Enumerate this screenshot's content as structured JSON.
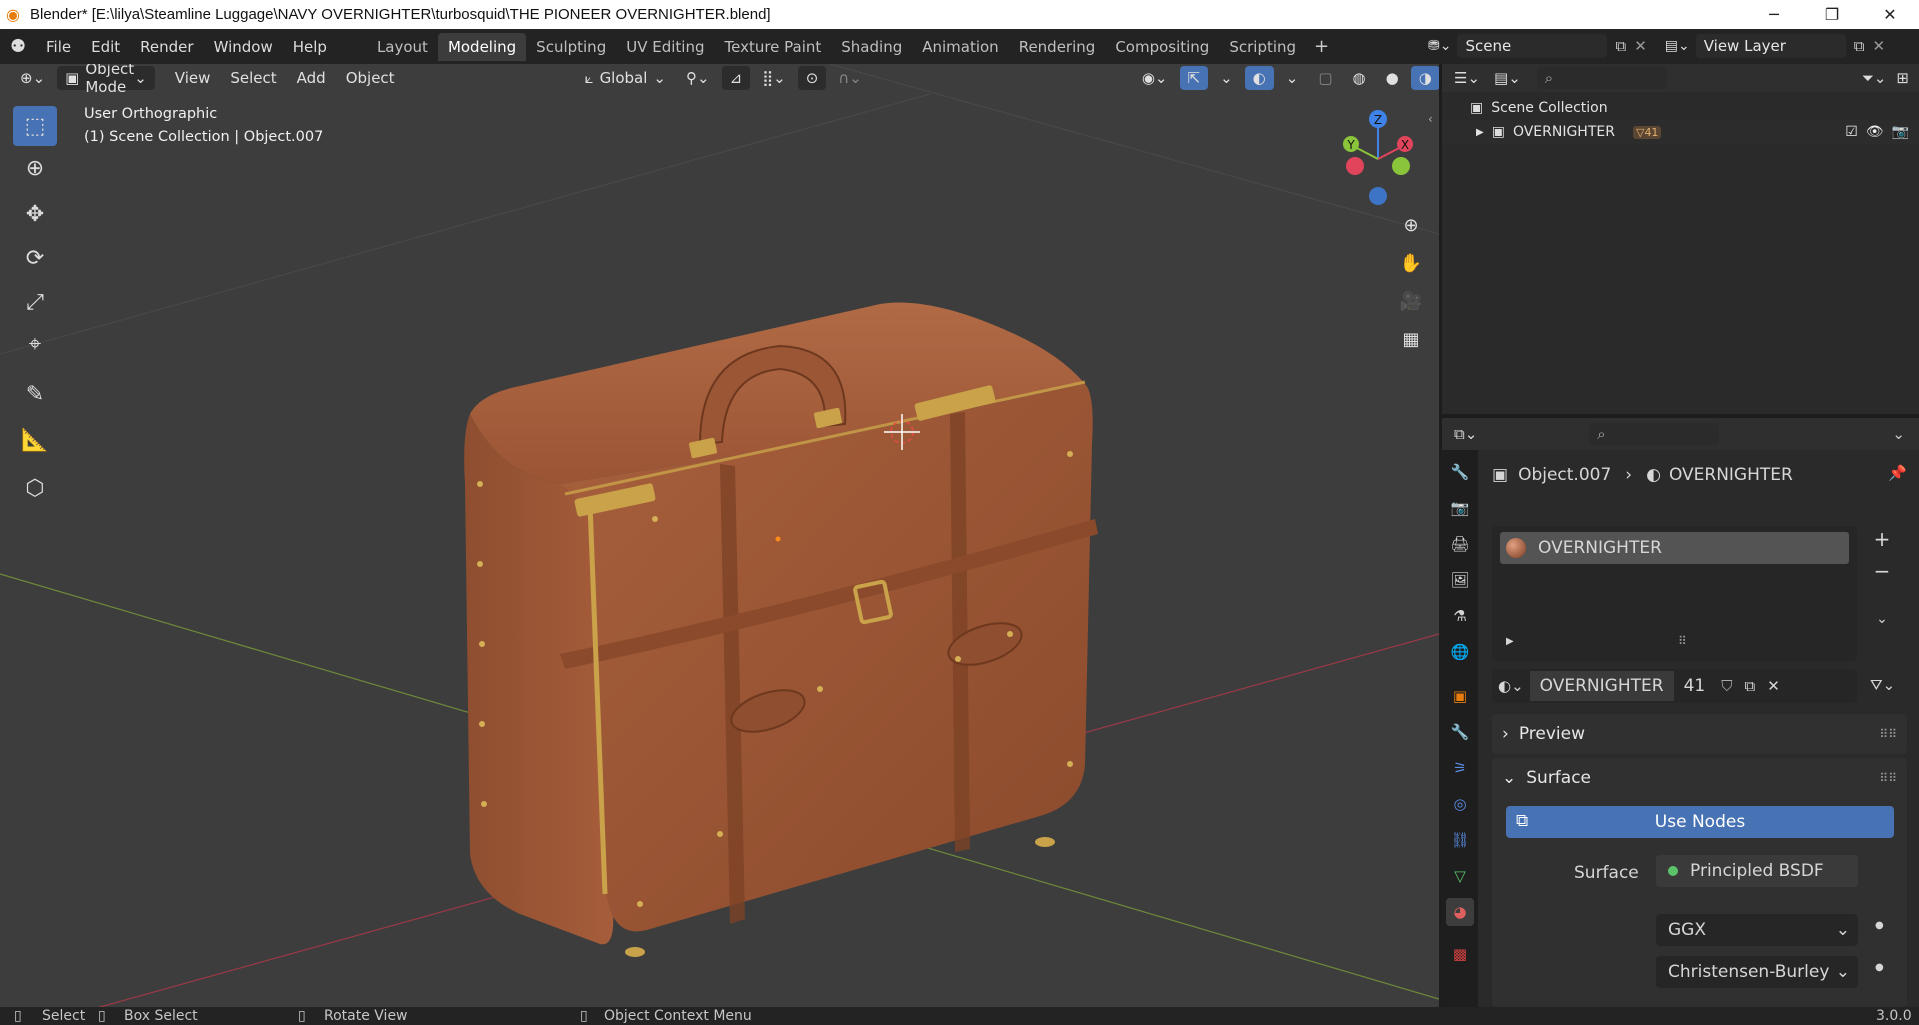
{
  "window": {
    "title": "Blender* [E:\\lilya\\Steamline Luggage\\NAVY OVERNIGHTER\\turbosquid\\THE PIONEER OVERNIGHTER.blend]",
    "minimize": "─",
    "restore": "❐",
    "close": "✕"
  },
  "menubar": {
    "items": [
      "File",
      "Edit",
      "Render",
      "Window",
      "Help"
    ],
    "workspaces": [
      "Layout",
      "Modeling",
      "Sculpting",
      "UV Editing",
      "Texture Paint",
      "Shading",
      "Animation",
      "Rendering",
      "Compositing",
      "Scripting"
    ],
    "active_workspace": "Modeling",
    "scene": "Scene",
    "view_layer": "View Layer"
  },
  "viewport": {
    "mode": "Object Mode",
    "menus": [
      "View",
      "Select",
      "Add",
      "Object"
    ],
    "transform_orientation": "Global",
    "view_name": "User Orthographic",
    "collection_info": "(1) Scene Collection | Object.007",
    "gizmo": {
      "x": "X",
      "y": "Y",
      "z": "Z"
    }
  },
  "outliner": {
    "root": "Scene Collection",
    "items": [
      {
        "name": "OVERNIGHTER",
        "badge": "41"
      }
    ]
  },
  "properties": {
    "breadcrumb_object": "Object.007",
    "breadcrumb_material": "OVERNIGHTER",
    "slot_name": "OVERNIGHTER",
    "material_name": "OVERNIGHTER",
    "user_count": "41",
    "panels": {
      "preview": "Preview",
      "surface": "Surface"
    },
    "use_nodes": "Use Nodes",
    "surface_label": "Surface",
    "surface_value": "Principled BSDF",
    "distribution": "GGX",
    "subsurface_method": "Christensen-Burley"
  },
  "statusbar": {
    "select": "Select",
    "box_select": "Box Select",
    "rotate_view": "Rotate View",
    "context_menu": "Object Context Menu",
    "version": "3.0.0"
  },
  "colors": {
    "accent": "#4772b3",
    "leather": "#9a5434",
    "brass": "#c9a24a",
    "axis_x": "#e0455c",
    "axis_y": "#8ac43a",
    "axis_z": "#3f82e8"
  }
}
